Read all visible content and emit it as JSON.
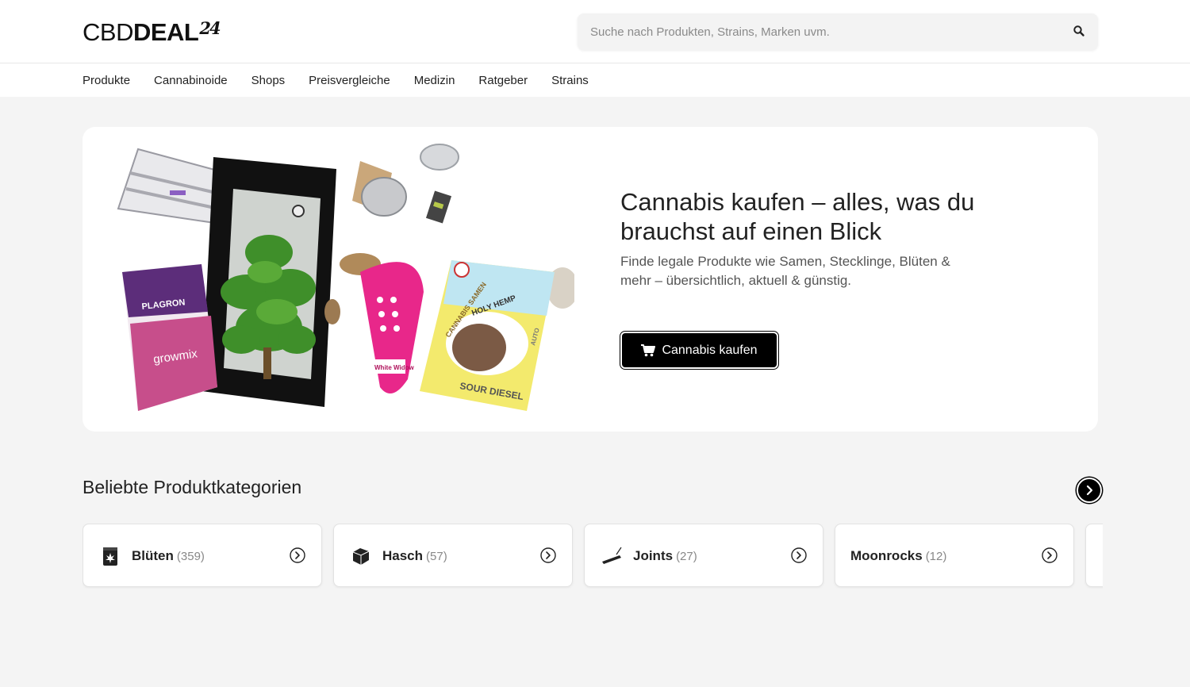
{
  "header": {
    "logo_light": "CBD",
    "logo_bold": "DEAL",
    "logo_super": "24",
    "search_placeholder": "Suche nach Produkten, Strains, Marken uvm.",
    "search_icon": "search-icon"
  },
  "nav": {
    "items": [
      {
        "label": "Produkte"
      },
      {
        "label": "Cannabinoide"
      },
      {
        "label": "Shops"
      },
      {
        "label": "Preisvergleiche"
      },
      {
        "label": "Medizin"
      },
      {
        "label": "Ratgeber"
      },
      {
        "label": "Strains"
      }
    ]
  },
  "hero": {
    "title": "Cannabis kaufen – alles, was du brauchst auf einen Blick",
    "subtitle": "Finde legale Produkte wie Samen, Stecklinge, Blüten & mehr – übersichtlich, aktuell & günstig.",
    "cta_label": "Cannabis kaufen",
    "cta_icon": "cart-icon",
    "image_labels": {
      "soil_brand": "PLAGRON",
      "soil_product": "growmix",
      "seed_pack_1": "White Widow",
      "seed_pack_2_brand": "HOLY HEMP",
      "seed_pack_2_strain": "SOUR DIESEL",
      "seed_pack_2_band": "CANNABIS SAMEN",
      "seed_pack_2_type": "AUTO"
    }
  },
  "categories": {
    "title": "Beliebte Produktkategorien",
    "next_icon": "chevron-right-icon",
    "items": [
      {
        "label": "Blüten",
        "count": "(359)",
        "icon": "flower-box-icon"
      },
      {
        "label": "Hasch",
        "count": "(57)",
        "icon": "hash-block-icon"
      },
      {
        "label": "Joints",
        "count": "(27)",
        "icon": "joint-icon"
      },
      {
        "label": "Moonrocks",
        "count": "(12)",
        "icon": ""
      }
    ]
  },
  "colors": {
    "page_bg": "#f4f4f4",
    "card_bg": "#ffffff",
    "cta_bg": "#000000",
    "text": "#222222"
  }
}
